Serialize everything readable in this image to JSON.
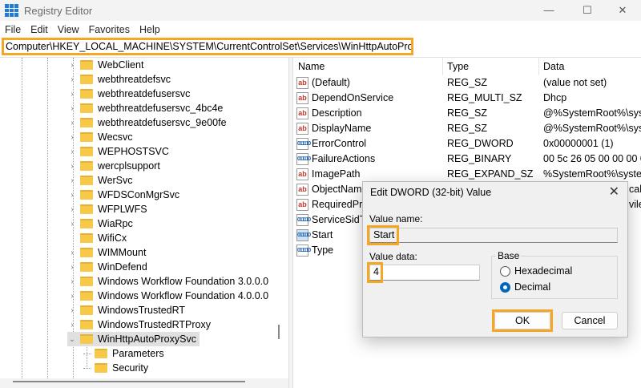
{
  "window": {
    "title": "Registry Editor",
    "minimize": "—",
    "maximize": "☐",
    "close": "✕"
  },
  "menu": [
    "File",
    "Edit",
    "View",
    "Favorites",
    "Help"
  ],
  "address": "Computer\\HKEY_LOCAL_MACHINE\\SYSTEM\\CurrentControlSet\\Services\\WinHttpAutoProxySvc",
  "tree": [
    {
      "label": "WebClient",
      "expand": "›"
    },
    {
      "label": "webthreatdefsvc",
      "expand": "›"
    },
    {
      "label": "webthreatdefusersvc",
      "expand": "›"
    },
    {
      "label": "webthreatdefusersvc_4bc4e",
      "expand": "›"
    },
    {
      "label": "webthreatdefusersvc_9e00fe",
      "expand": "›"
    },
    {
      "label": "Wecsvc",
      "expand": "›"
    },
    {
      "label": "WEPHOSTSVC",
      "expand": "›"
    },
    {
      "label": "wercplsupport",
      "expand": "›"
    },
    {
      "label": "WerSvc",
      "expand": "›"
    },
    {
      "label": "WFDSConMgrSvc",
      "expand": "›"
    },
    {
      "label": "WFPLWFS",
      "expand": "›"
    },
    {
      "label": "WiaRpc",
      "expand": "›"
    },
    {
      "label": "WifiCx",
      "expand": ""
    },
    {
      "label": "WIMMount",
      "expand": "›"
    },
    {
      "label": "WinDefend",
      "expand": "›"
    },
    {
      "label": "Windows Workflow Foundation 3.0.0.0",
      "expand": "›"
    },
    {
      "label": "Windows Workflow Foundation 4.0.0.0",
      "expand": "›"
    },
    {
      "label": "WindowsTrustedRT",
      "expand": "›"
    },
    {
      "label": "WindowsTrustedRTProxy",
      "expand": "›"
    },
    {
      "label": "WinHttpAutoProxySvc",
      "expand": "⌄",
      "selected": true
    },
    {
      "label": "Parameters",
      "expand": "",
      "child": true
    },
    {
      "label": "Security",
      "expand": "",
      "child": true
    }
  ],
  "list": {
    "columns": [
      "Name",
      "Type",
      "Data"
    ],
    "rows": [
      {
        "icon": "ab",
        "name": "(Default)",
        "type": "REG_SZ",
        "data": "(value not set)"
      },
      {
        "icon": "ab",
        "name": "DependOnService",
        "type": "REG_MULTI_SZ",
        "data": "Dhcp"
      },
      {
        "icon": "ab",
        "name": "Description",
        "type": "REG_SZ",
        "data": "@%SystemRoot%\\syste"
      },
      {
        "icon": "ab",
        "name": "DisplayName",
        "type": "REG_SZ",
        "data": "@%SystemRoot%\\syste"
      },
      {
        "icon": "bin",
        "name": "ErrorControl",
        "type": "REG_DWORD",
        "data": "0x00000001 (1)"
      },
      {
        "icon": "bin",
        "name": "FailureActions",
        "type": "REG_BINARY",
        "data": "00 5c 26 05 00 00 00 00 0"
      },
      {
        "icon": "ab",
        "name": "ImagePath",
        "type": "REG_EXPAND_SZ",
        "data": "%SystemRoot%\\system"
      },
      {
        "icon": "ab",
        "name": "ObjectName",
        "type": "",
        "data": "calSe"
      },
      {
        "icon": "ab",
        "name": "RequiredPrivileges",
        "type": "",
        "data": "vileg"
      },
      {
        "icon": "bin",
        "name": "ServiceSidType",
        "type": "",
        "data": ""
      },
      {
        "icon": "bin",
        "name": "Start",
        "type": "",
        "data": "",
        "selected": true
      },
      {
        "icon": "bin",
        "name": "Type",
        "type": "",
        "data": ""
      }
    ]
  },
  "dialog": {
    "title": "Edit DWORD (32-bit) Value",
    "close": "✕",
    "value_name_label": "Value name:",
    "value_name": "Start",
    "value_data_label": "Value data:",
    "value_data": "4",
    "base_label": "Base",
    "base_options": [
      "Hexadecimal",
      "Decimal"
    ],
    "base_selected": "Decimal",
    "ok": "OK",
    "cancel": "Cancel"
  },
  "highlight_color": "#f5a623"
}
